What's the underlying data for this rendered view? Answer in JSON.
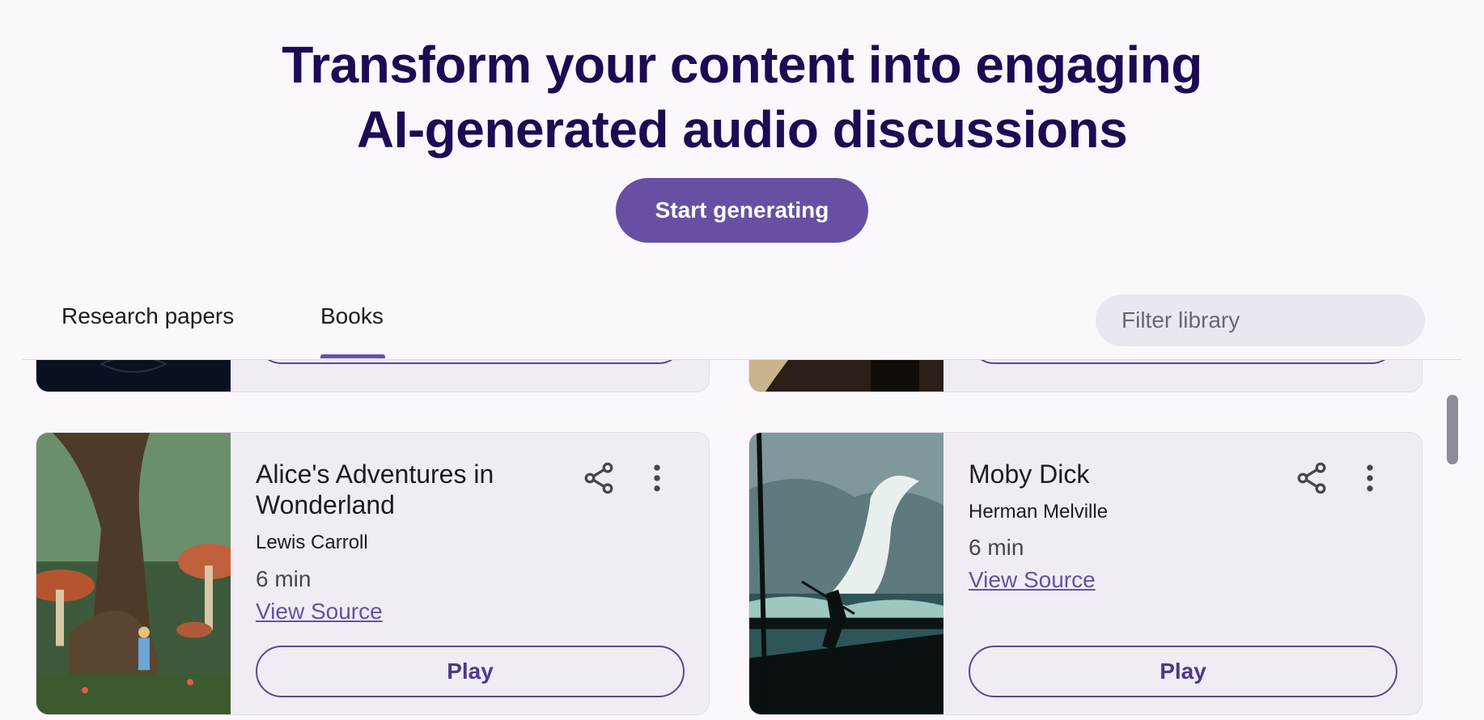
{
  "hero": {
    "title_line1": "Transform your content into engaging",
    "title_line2": "AI-generated audio discussions",
    "cta_label": "Start generating"
  },
  "tabs": [
    {
      "label": "Research papers",
      "selected": false
    },
    {
      "label": "Books",
      "selected": true
    }
  ],
  "filter": {
    "placeholder": "Filter library",
    "value": ""
  },
  "cards": [
    {
      "title": "Alice's Adventures in Wonderland",
      "author": "Lewis Carroll",
      "duration": "6 min",
      "source_label": "View Source",
      "play_label": "Play"
    },
    {
      "title": "Moby Dick",
      "author": "Herman Melville",
      "duration": "6 min",
      "source_label": "View Source",
      "play_label": "Play"
    }
  ],
  "icons": {
    "filter": "search-icon",
    "share": "share-icon",
    "more": "more-vert-icon"
  },
  "colors": {
    "primary": "#6750a4",
    "title": "#1e0a54",
    "card_bg": "#f1ecf4",
    "page_bg": "#fcf7fd"
  }
}
